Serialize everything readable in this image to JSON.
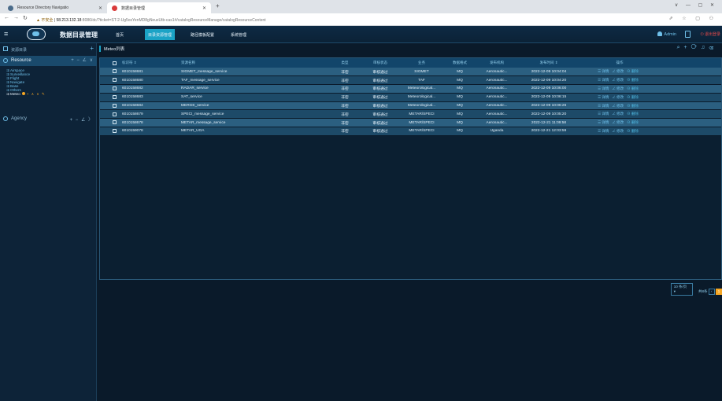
{
  "browser": {
    "tabs": [
      {
        "title": "Resource Directory Navigatio"
      },
      {
        "title": "数据目录管理"
      }
    ],
    "new_tab": "+",
    "window_controls": "∨ — ▢ ✕",
    "url_warning": "▲ 不安全",
    "url_host": "58.213.132.18",
    "url_path": ":8086/dc/?ticket=ST-2-Ug5oxYenMD8gNeuxUtb-cas1#/catalogResourceManage/catalogResourceContent"
  },
  "header": {
    "app_title": "数据目录管理",
    "nav": [
      {
        "label": "首页",
        "active": false
      },
      {
        "label": "目录资源管理",
        "active": true
      },
      {
        "label": "路径模板配置",
        "active": false
      },
      {
        "label": "系统管理",
        "active": false
      }
    ],
    "user": "Admin",
    "logout": "退出登录"
  },
  "sidebar": {
    "head_label": "资源目录",
    "resource_label": "Resource",
    "resource_actions": "+ − ∠ ∨",
    "tree": [
      {
        "label": "Airspace",
        "selected": false
      },
      {
        "label": "Surveillance",
        "selected": false
      },
      {
        "label": "Flight",
        "selected": false
      },
      {
        "label": "Navigate",
        "selected": false
      },
      {
        "label": "Base",
        "selected": false
      },
      {
        "label": "Others",
        "selected": false
      },
      {
        "label": "Meteo",
        "selected": true
      }
    ],
    "meteo_actions": "+ ∧ ∨ ✎",
    "agency_label": "Agency",
    "agency_actions": "+ − ∠ 〉"
  },
  "main": {
    "section_title": "Meteo列表",
    "columns": [
      "标识符 ⇕",
      "资源名称",
      "类型",
      "审核状态",
      "业务",
      "数据格式",
      "发布机构",
      "发布时间 ⇕",
      "操作"
    ],
    "rows": [
      {
        "id": "6010158681",
        "name": "SIGMET_message_service",
        "type": "非密",
        "status": "审核通过",
        "biz": "SIGMET",
        "format": "MQ",
        "org": "Aeronautic...",
        "time": "2022-12-09 10:04:04"
      },
      {
        "id": "6010158680",
        "name": "TAF_message_service",
        "type": "非密",
        "status": "审核通过",
        "biz": "TAF",
        "format": "MQ",
        "org": "Aeronautic...",
        "time": "2022-12-09 10:04:20"
      },
      {
        "id": "6010158682",
        "name": "RADAR_service",
        "type": "非密",
        "status": "审核通过",
        "biz": "Meteorological...",
        "format": "MQ",
        "org": "Aeronautic...",
        "time": "2022-12-09 10:06:00"
      },
      {
        "id": "6010158683",
        "name": "SAT_service",
        "type": "非密",
        "status": "审核通过",
        "biz": "Meteorological...",
        "format": "MQ",
        "org": "Aeronautic...",
        "time": "2022-12-09 10:06:15"
      },
      {
        "id": "6010158684",
        "name": "MERGE_service",
        "type": "非密",
        "status": "审核通过",
        "biz": "Meteorological...",
        "format": "MQ",
        "org": "Aeronautic...",
        "time": "2022-12-09 10:06:26"
      },
      {
        "id": "6010158679",
        "name": "SPECI_message_service",
        "type": "非密",
        "status": "审核通过",
        "biz": "METAR/SPECI",
        "format": "MQ",
        "org": "Aeronautic...",
        "time": "2022-12-09 10:05:20"
      },
      {
        "id": "6010158678",
        "name": "METAR_message_service",
        "type": "非密",
        "status": "审核通过",
        "biz": "METAR/SPECI",
        "format": "MQ",
        "org": "Aeronautic...",
        "time": "2022-12-21 11:09:58"
      },
      {
        "id": "6010159078",
        "name": "METAR_UGA",
        "type": "非密",
        "status": "审核通过",
        "biz": "METAR/SPECI",
        "format": "MQ",
        "org": "Uganda",
        "time": "2022-12-21 12:03:59"
      }
    ],
    "row_actions": {
      "detail": "☰ 详情",
      "edit": "∠ 修改",
      "delete": "⊖ 删除"
    },
    "pager": {
      "page_size": "10 条/页",
      "total": "共8条",
      "current_page": "1"
    }
  },
  "colors": {
    "accent": "#1ba3c6",
    "header_bg": "#0e2a44",
    "row_a": "#2b5f80",
    "row_b": "#1d4a68",
    "danger": "#e84a4a",
    "highlight": "#f5a623"
  }
}
